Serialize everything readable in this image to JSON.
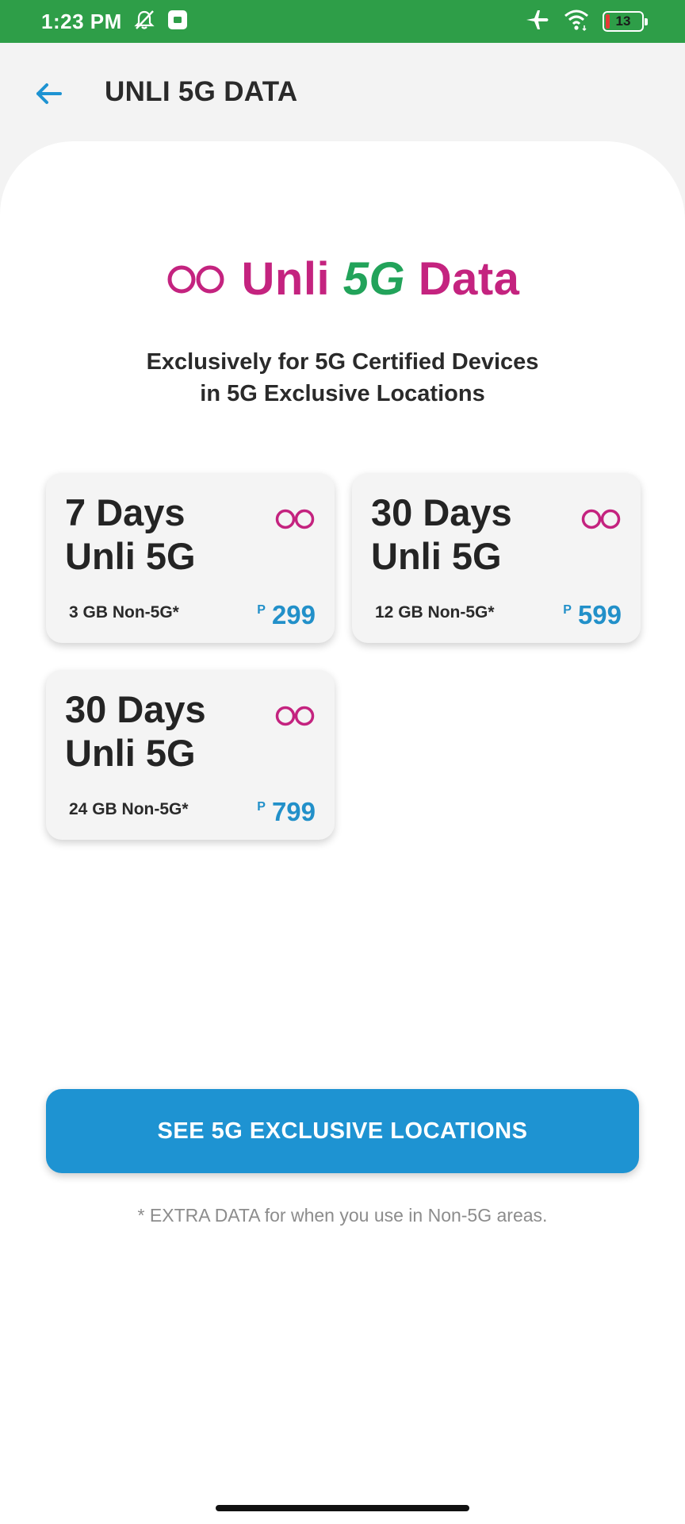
{
  "status_bar": {
    "time": "1:23 PM",
    "battery_level": 13,
    "battery_text": "13",
    "icons": [
      "alarm-off-icon",
      "notification-app-icon",
      "airplane-icon",
      "wifi-icon",
      "battery-icon"
    ]
  },
  "header": {
    "title": "UNLI 5G DATA",
    "back_icon": "arrow-left-icon"
  },
  "promo": {
    "logo_unli": "Unli",
    "logo_5g": "5G",
    "logo_data": "Data",
    "tagline_line1": "Exclusively for 5G Certified Devices",
    "tagline_line2": "in 5G Exclusive Locations"
  },
  "offers": [
    {
      "line1": "7 Days",
      "line2": "Unli 5G",
      "bonus": "3 GB Non-5G*",
      "currency": "P",
      "price": "299"
    },
    {
      "line1": "30 Days",
      "line2": "Unli 5G",
      "bonus": "12 GB Non-5G*",
      "currency": "P",
      "price": "599"
    },
    {
      "line1": "30 Days",
      "line2": "Unli 5G",
      "bonus": "24 GB Non-5G*",
      "currency": "P",
      "price": "799"
    }
  ],
  "cta": {
    "label": "SEE 5G EXCLUSIVE LOCATIONS"
  },
  "footnote": "* EXTRA DATA for when you use in Non-5G areas.",
  "colors": {
    "status_bar": "#2e9e48",
    "brand_magenta": "#c4237f",
    "brand_green": "#22a35a",
    "price_blue": "#2290c9",
    "cta_blue": "#1e93d2"
  }
}
